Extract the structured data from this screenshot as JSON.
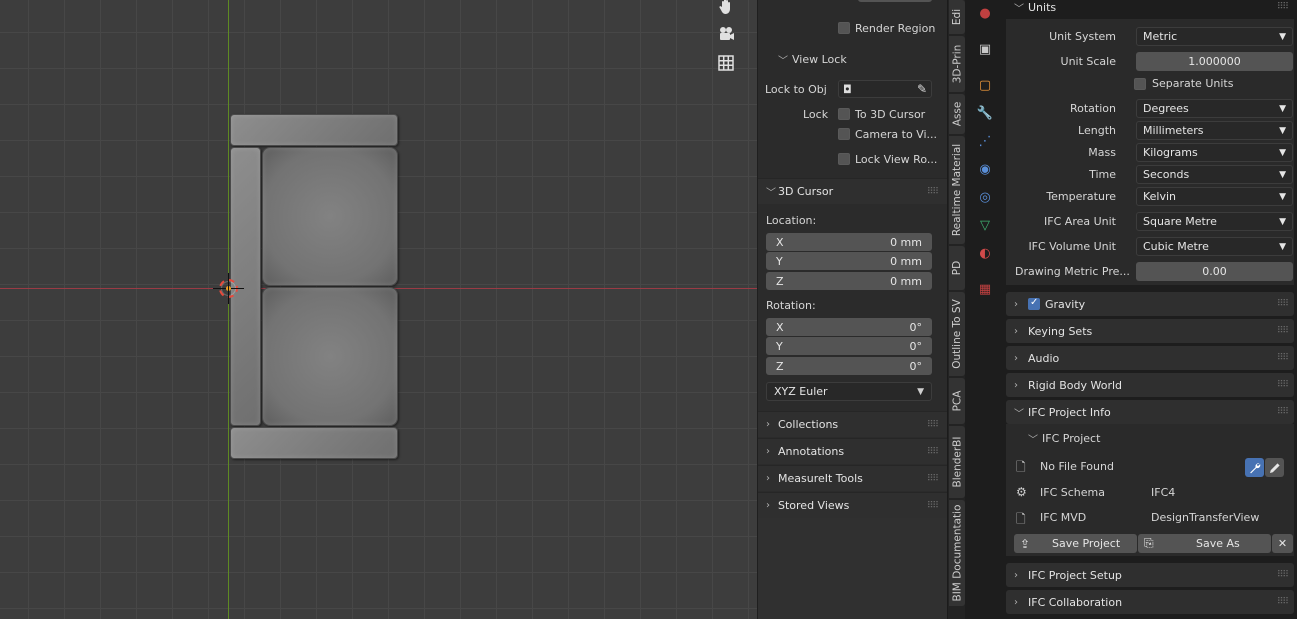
{
  "viewport": {
    "gizmo_icons": [
      "hand-icon",
      "camera-icon",
      "grid-icon"
    ]
  },
  "npanel": {
    "render_region_label": "Render Region",
    "view_lock": {
      "title": "View Lock",
      "lock_to_obj_label": "Lock to Obj",
      "lock_label": "Lock",
      "to_3d_cursor_label": "To 3D Cursor",
      "camera_to_view_label": "Camera to Vi...",
      "lock_view_rotation_label": "Lock View Ro..."
    },
    "cursor": {
      "title": "3D Cursor",
      "location_label": "Location:",
      "location": [
        {
          "axis": "X",
          "value": "0 mm"
        },
        {
          "axis": "Y",
          "value": "0 mm"
        },
        {
          "axis": "Z",
          "value": "0 mm"
        }
      ],
      "rotation_label": "Rotation:",
      "rotation": [
        {
          "axis": "X",
          "value": "0°"
        },
        {
          "axis": "Y",
          "value": "0°"
        },
        {
          "axis": "Z",
          "value": "0°"
        }
      ],
      "rotation_mode": "XYZ Euler"
    },
    "collapsed_sections": [
      "Collections",
      "Annotations",
      "MeasureIt Tools",
      "Stored Views"
    ]
  },
  "tabs": [
    "Edi",
    "3D-Prin",
    "Asse",
    "Realtime Material",
    "PD",
    "Outline To SV",
    "PCA",
    "BlenderBI",
    "BIM Documentatio"
  ],
  "properties": {
    "units": {
      "title": "Units",
      "unit_system_label": "Unit System",
      "unit_system": "Metric",
      "unit_scale_label": "Unit Scale",
      "unit_scale": "1.000000",
      "separate_units_label": "Separate Units",
      "rotation_label": "Rotation",
      "rotation": "Degrees",
      "length_label": "Length",
      "length": "Millimeters",
      "mass_label": "Mass",
      "mass": "Kilograms",
      "time_label": "Time",
      "time": "Seconds",
      "temperature_label": "Temperature",
      "temperature": "Kelvin",
      "ifc_area_label": "IFC Area Unit",
      "ifc_area": "Square Metre",
      "ifc_volume_label": "IFC Volume Unit",
      "ifc_volume": "Cubic Metre",
      "drawing_metric_label": "Drawing Metric Pre...",
      "drawing_metric": "0.00"
    },
    "gravity_label": "Gravity",
    "keying_sets": "Keying Sets",
    "audio": "Audio",
    "rigid_body_world": "Rigid Body World",
    "ifc_project_info": {
      "title": "IFC Project Info",
      "subtitle": "IFC Project",
      "file_label": "No File Found",
      "schema_label": "IFC Schema",
      "schema_value": "IFC4",
      "mvd_label": "IFC MVD",
      "mvd_value": "DesignTransferView",
      "save_project_label": "Save Project",
      "save_as_label": "Save As"
    },
    "ifc_project_setup": "IFC Project Setup",
    "ifc_collaboration": "IFC Collaboration"
  },
  "colors": {
    "accent": "#4772b3",
    "x_axis": "#9a3b45",
    "y_axis": "#5e8a23"
  }
}
